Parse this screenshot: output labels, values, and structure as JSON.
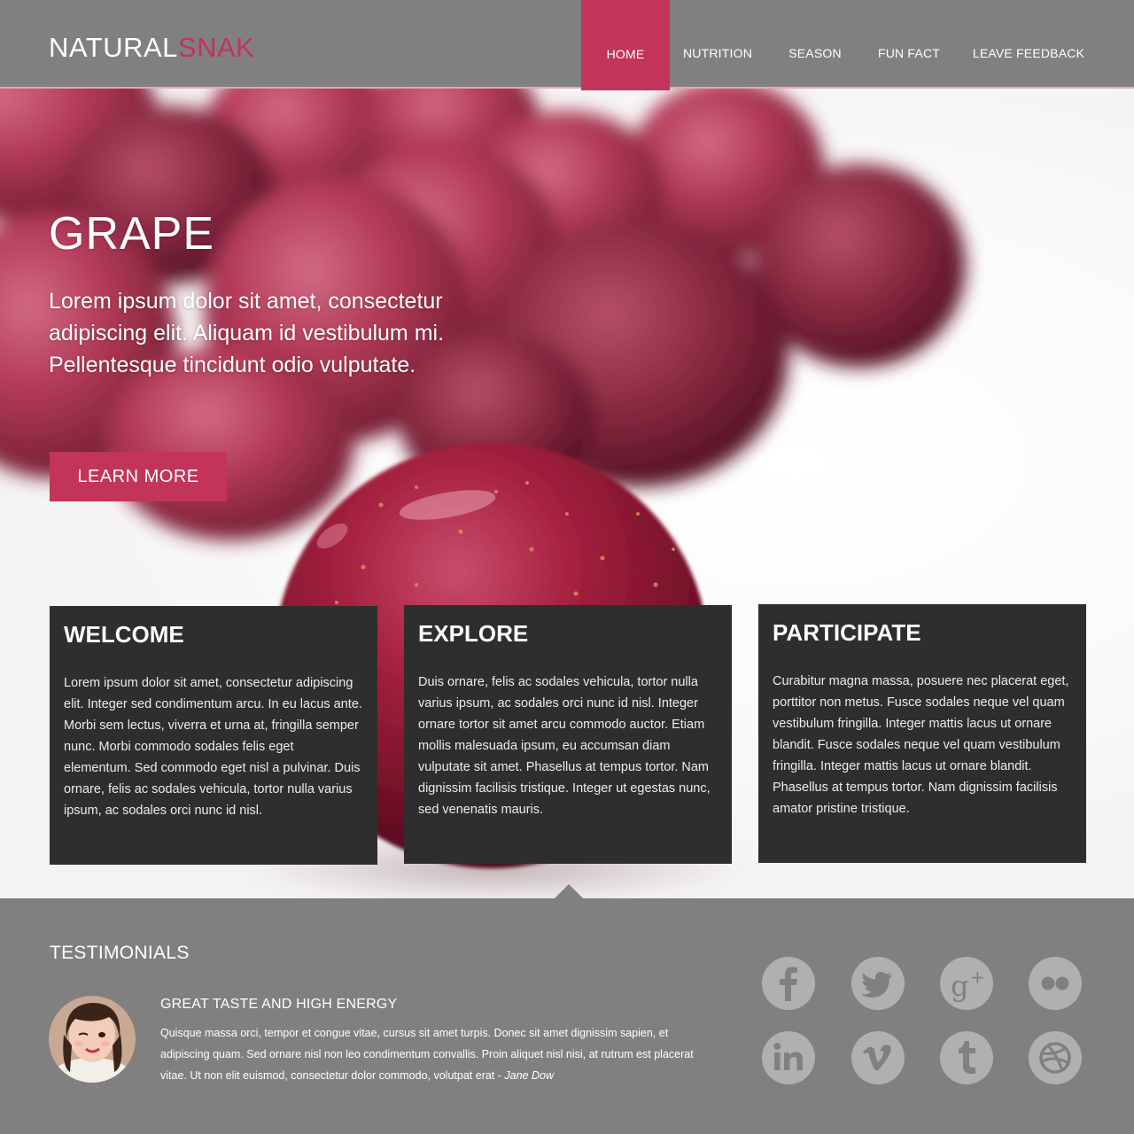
{
  "header": {
    "logo_part1": "NATURAL",
    "logo_part2": "SNAK",
    "nav": [
      {
        "label": "HOME",
        "active": true
      },
      {
        "label": "NUTRITION",
        "active": false
      },
      {
        "label": "SEASON",
        "active": false
      },
      {
        "label": "FUN FACT",
        "active": false
      },
      {
        "label": "LEAVE FEEDBACK",
        "active": false
      }
    ]
  },
  "hero": {
    "title": "GRAPE",
    "text": "Lorem ipsum dolor sit amet, consectetur adipiscing elit. Aliquam id vestibulum mi. Pellentesque tincidunt odio vulputate.",
    "button_label": "LEARN MORE"
  },
  "cards": [
    {
      "title": "WELCOME",
      "body": "Lorem ipsum dolor sit amet, consectetur adipiscing elit. Integer sed condimentum arcu. In eu lacus ante. Morbi sem lectus, viverra et urna at, fringilla semper nunc. Morbi commodo sodales felis eget elementum. Sed commodo eget nisl a pulvinar. Duis ornare, felis ac sodales vehicula, tortor nulla varius ipsum, ac sodales orci nunc id nisl."
    },
    {
      "title": "EXPLORE",
      "body": "Duis ornare, felis ac sodales vehicula, tortor nulla varius ipsum, ac sodales orci nunc id nisl. Integer ornare tortor sit amet arcu commodo auctor. Etiam mollis malesuada ipsum, eu accumsan diam vulputate sit amet. Phasellus at tempus tortor. Nam dignissim facilisis tristique. Integer ut egestas nunc, sed venenatis mauris."
    },
    {
      "title": "PARTICIPATE",
      "body": "Curabitur magna massa, posuere nec placerat eget, porttitor non metus. Fusce sodales neque vel quam vestibulum fringilla. Integer mattis lacus ut ornare blandit. Fusce sodales neque vel quam vestibulum fringilla. Integer mattis lacus ut ornare blandit. Phasellus at tempus tortor. Nam dignissim facilisis amator pristine tristique."
    }
  ],
  "testimonials": {
    "heading": "TESTIMONIALS",
    "title": "GREAT TASTE AND HIGH ENERGY",
    "text": "Quisque massa orci, tempor et congue vitae, cursus sit amet turpis. Donec sit amet dignissim sapien, et adipiscing quam. Sed ornare nisl non leo condimentum convallis. Proin aliquet nisl nisi, at rutrum est placerat vitae. Ut non elit euismod, consectetur dolor commodo, volutpat erat - ",
    "author": "Jane Dow"
  },
  "social_icons": [
    "facebook-icon",
    "twitter-icon",
    "google-plus-icon",
    "flickr-icon",
    "linkedin-icon",
    "vimeo-icon",
    "tumblr-icon",
    "dribbble-icon"
  ],
  "colors": {
    "accent": "#c2345a",
    "header_bg": "#808080",
    "card_bg": "#2e2e2e",
    "footer_bg": "#808080",
    "icon_bg": "#b0b0b0"
  }
}
